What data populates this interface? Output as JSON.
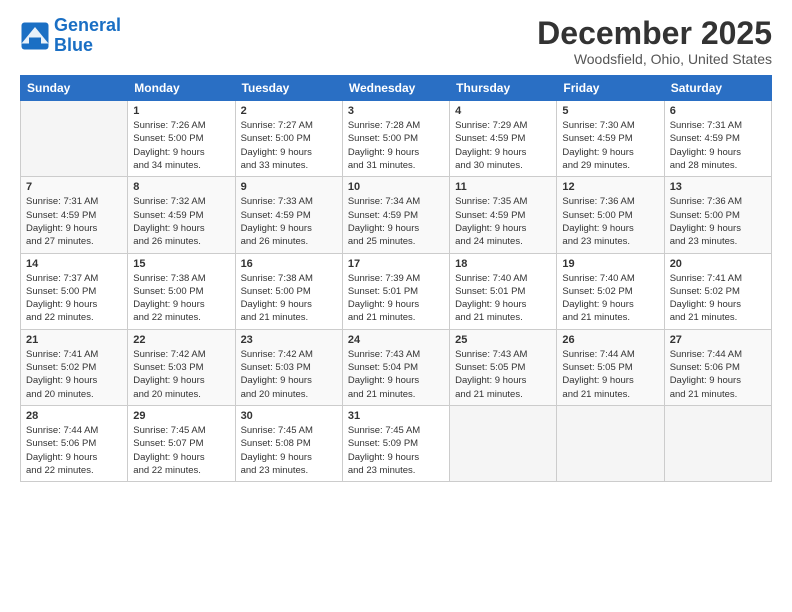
{
  "logo": {
    "line1": "General",
    "line2": "Blue"
  },
  "title": "December 2025",
  "location": "Woodsfield, Ohio, United States",
  "weekdays": [
    "Sunday",
    "Monday",
    "Tuesday",
    "Wednesday",
    "Thursday",
    "Friday",
    "Saturday"
  ],
  "weeks": [
    [
      {
        "day": "",
        "info": ""
      },
      {
        "day": "1",
        "info": "Sunrise: 7:26 AM\nSunset: 5:00 PM\nDaylight: 9 hours\nand 34 minutes."
      },
      {
        "day": "2",
        "info": "Sunrise: 7:27 AM\nSunset: 5:00 PM\nDaylight: 9 hours\nand 33 minutes."
      },
      {
        "day": "3",
        "info": "Sunrise: 7:28 AM\nSunset: 5:00 PM\nDaylight: 9 hours\nand 31 minutes."
      },
      {
        "day": "4",
        "info": "Sunrise: 7:29 AM\nSunset: 4:59 PM\nDaylight: 9 hours\nand 30 minutes."
      },
      {
        "day": "5",
        "info": "Sunrise: 7:30 AM\nSunset: 4:59 PM\nDaylight: 9 hours\nand 29 minutes."
      },
      {
        "day": "6",
        "info": "Sunrise: 7:31 AM\nSunset: 4:59 PM\nDaylight: 9 hours\nand 28 minutes."
      }
    ],
    [
      {
        "day": "7",
        "info": "Sunrise: 7:31 AM\nSunset: 4:59 PM\nDaylight: 9 hours\nand 27 minutes."
      },
      {
        "day": "8",
        "info": "Sunrise: 7:32 AM\nSunset: 4:59 PM\nDaylight: 9 hours\nand 26 minutes."
      },
      {
        "day": "9",
        "info": "Sunrise: 7:33 AM\nSunset: 4:59 PM\nDaylight: 9 hours\nand 26 minutes."
      },
      {
        "day": "10",
        "info": "Sunrise: 7:34 AM\nSunset: 4:59 PM\nDaylight: 9 hours\nand 25 minutes."
      },
      {
        "day": "11",
        "info": "Sunrise: 7:35 AM\nSunset: 4:59 PM\nDaylight: 9 hours\nand 24 minutes."
      },
      {
        "day": "12",
        "info": "Sunrise: 7:36 AM\nSunset: 5:00 PM\nDaylight: 9 hours\nand 23 minutes."
      },
      {
        "day": "13",
        "info": "Sunrise: 7:36 AM\nSunset: 5:00 PM\nDaylight: 9 hours\nand 23 minutes."
      }
    ],
    [
      {
        "day": "14",
        "info": "Sunrise: 7:37 AM\nSunset: 5:00 PM\nDaylight: 9 hours\nand 22 minutes."
      },
      {
        "day": "15",
        "info": "Sunrise: 7:38 AM\nSunset: 5:00 PM\nDaylight: 9 hours\nand 22 minutes."
      },
      {
        "day": "16",
        "info": "Sunrise: 7:38 AM\nSunset: 5:00 PM\nDaylight: 9 hours\nand 21 minutes."
      },
      {
        "day": "17",
        "info": "Sunrise: 7:39 AM\nSunset: 5:01 PM\nDaylight: 9 hours\nand 21 minutes."
      },
      {
        "day": "18",
        "info": "Sunrise: 7:40 AM\nSunset: 5:01 PM\nDaylight: 9 hours\nand 21 minutes."
      },
      {
        "day": "19",
        "info": "Sunrise: 7:40 AM\nSunset: 5:02 PM\nDaylight: 9 hours\nand 21 minutes."
      },
      {
        "day": "20",
        "info": "Sunrise: 7:41 AM\nSunset: 5:02 PM\nDaylight: 9 hours\nand 21 minutes."
      }
    ],
    [
      {
        "day": "21",
        "info": "Sunrise: 7:41 AM\nSunset: 5:02 PM\nDaylight: 9 hours\nand 20 minutes."
      },
      {
        "day": "22",
        "info": "Sunrise: 7:42 AM\nSunset: 5:03 PM\nDaylight: 9 hours\nand 20 minutes."
      },
      {
        "day": "23",
        "info": "Sunrise: 7:42 AM\nSunset: 5:03 PM\nDaylight: 9 hours\nand 20 minutes."
      },
      {
        "day": "24",
        "info": "Sunrise: 7:43 AM\nSunset: 5:04 PM\nDaylight: 9 hours\nand 21 minutes."
      },
      {
        "day": "25",
        "info": "Sunrise: 7:43 AM\nSunset: 5:05 PM\nDaylight: 9 hours\nand 21 minutes."
      },
      {
        "day": "26",
        "info": "Sunrise: 7:44 AM\nSunset: 5:05 PM\nDaylight: 9 hours\nand 21 minutes."
      },
      {
        "day": "27",
        "info": "Sunrise: 7:44 AM\nSunset: 5:06 PM\nDaylight: 9 hours\nand 21 minutes."
      }
    ],
    [
      {
        "day": "28",
        "info": "Sunrise: 7:44 AM\nSunset: 5:06 PM\nDaylight: 9 hours\nand 22 minutes."
      },
      {
        "day": "29",
        "info": "Sunrise: 7:45 AM\nSunset: 5:07 PM\nDaylight: 9 hours\nand 22 minutes."
      },
      {
        "day": "30",
        "info": "Sunrise: 7:45 AM\nSunset: 5:08 PM\nDaylight: 9 hours\nand 23 minutes."
      },
      {
        "day": "31",
        "info": "Sunrise: 7:45 AM\nSunset: 5:09 PM\nDaylight: 9 hours\nand 23 minutes."
      },
      {
        "day": "",
        "info": ""
      },
      {
        "day": "",
        "info": ""
      },
      {
        "day": "",
        "info": ""
      }
    ]
  ]
}
